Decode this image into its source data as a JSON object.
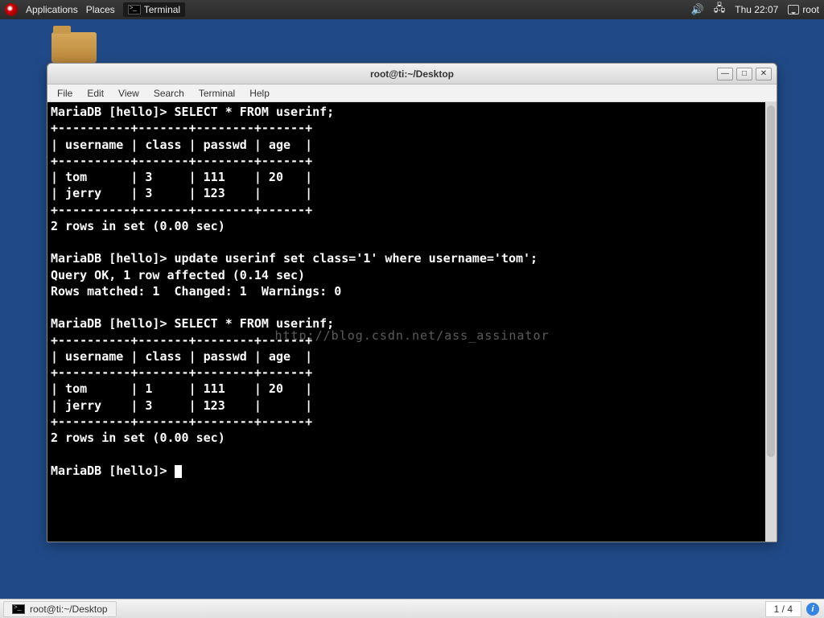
{
  "top_panel": {
    "applications": "Applications",
    "places": "Places",
    "task": "Terminal",
    "clock": "Thu 22:07",
    "user": "root"
  },
  "bottom_panel": {
    "task": "root@ti:~/Desktop",
    "workspace": "1 / 4"
  },
  "window": {
    "title": "root@ti:~/Desktop",
    "menu": {
      "file": "File",
      "edit": "Edit",
      "view": "View",
      "search": "Search",
      "terminal": "Terminal",
      "help": "Help"
    }
  },
  "watermark": "http://blog.csdn.net/ass_assinator",
  "db": {
    "prompt": "MariaDB [hello]> ",
    "select_cmd": "SELECT * FROM userinf;",
    "update_cmd": "update userinf set class='1' where username='tom';",
    "query_ok": "Query OK, 1 row affected (0.14 sec)",
    "rows_matched": "Rows matched: 1  Changed: 1  Warnings: 0",
    "rows_in_set": "2 rows in set (0.00 sec)",
    "columns": [
      "username",
      "class",
      "passwd",
      "age"
    ],
    "border": "+----------+-------+--------+------+",
    "header": "| username | class | passwd | age  |",
    "before": [
      "| tom      | 3     | 111    | 20   |",
      "| jerry    | 3     | 123    |      |"
    ],
    "after": [
      "| tom      | 1     | 111    | 20   |",
      "| jerry    | 3     | 123    |      |"
    ]
  }
}
